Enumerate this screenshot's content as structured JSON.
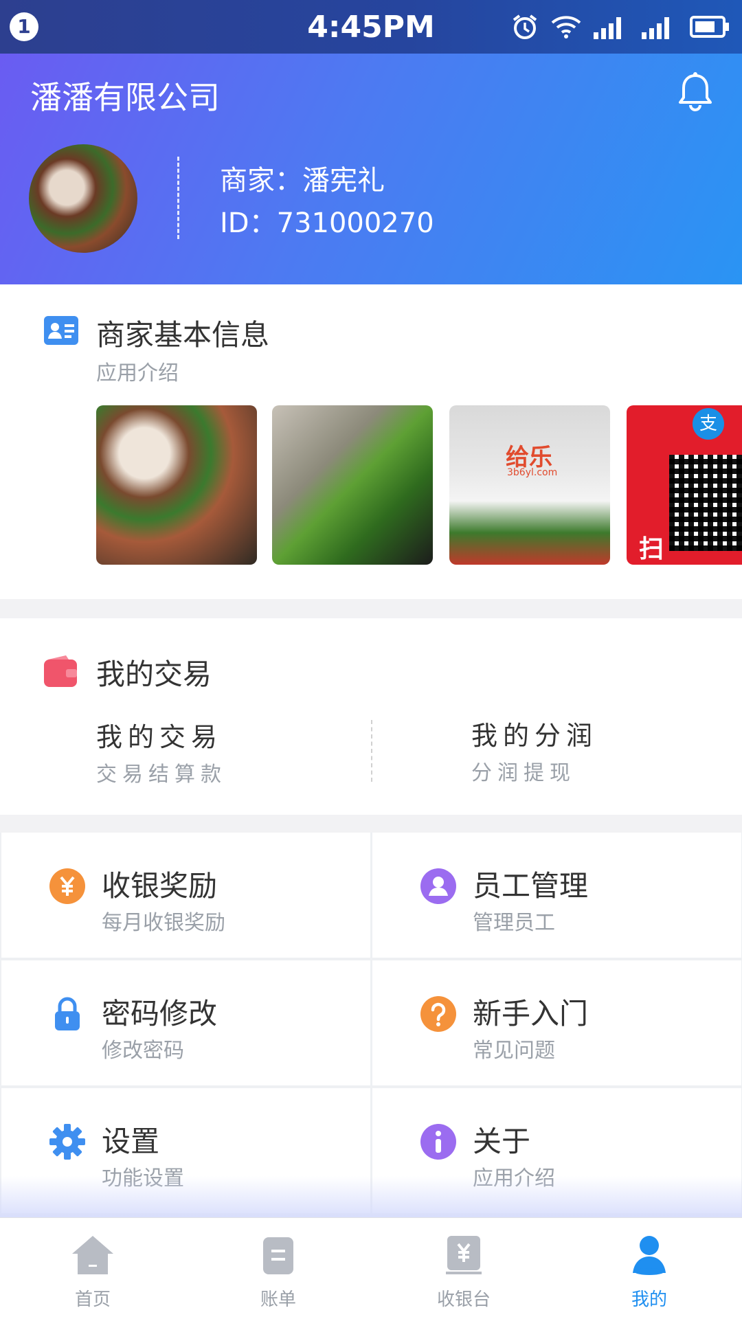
{
  "status_bar": {
    "notification_count": "1",
    "time": "4:45PM"
  },
  "header": {
    "company_name": "潘潘有限公司",
    "merchant_label": "商家：潘宪礼",
    "id_label": "ID：731000270"
  },
  "merchant_info": {
    "title": "商家基本信息",
    "subtitle": "应用介绍",
    "photo_brand_text": "给乐",
    "photo_brand_domain": "3b6yl.com",
    "photo_alipay_text": "支",
    "photo_scan_text": "扫"
  },
  "transactions": {
    "title": "我的交易",
    "items": [
      {
        "title": "我的交易",
        "subtitle": "交易结算款"
      },
      {
        "title": "我的分润",
        "subtitle": "分润提现"
      }
    ]
  },
  "grid": [
    {
      "title": "收银奖励",
      "subtitle": "每月收银奖励",
      "icon": "yuan-coin-icon",
      "color": "#f5923b"
    },
    {
      "title": "员工管理",
      "subtitle": "管理员工",
      "icon": "user-icon",
      "color": "#9b6cf0"
    },
    {
      "title": "密码修改",
      "subtitle": "修改密码",
      "icon": "lock-icon",
      "color": "#3f8ff0"
    },
    {
      "title": "新手入门",
      "subtitle": "常见问题",
      "icon": "question-icon",
      "color": "#f5923b"
    },
    {
      "title": "设置",
      "subtitle": "功能设置",
      "icon": "gear-icon",
      "color": "#3f8ff0"
    },
    {
      "title": "关于",
      "subtitle": "应用介绍",
      "icon": "info-icon",
      "color": "#9b6cf0"
    }
  ],
  "bottom_nav": [
    {
      "label": "首页",
      "icon": "home-icon",
      "active": false
    },
    {
      "label": "账单",
      "icon": "bill-icon",
      "active": false
    },
    {
      "label": "收银台",
      "icon": "cashier-icon",
      "active": false
    },
    {
      "label": "我的",
      "icon": "profile-icon",
      "active": true
    }
  ],
  "colors": {
    "accent": "#1f8ff0",
    "header_start": "#6a5cf2",
    "header_end": "#2a94f3",
    "muted_text": "#9aa0a8"
  }
}
